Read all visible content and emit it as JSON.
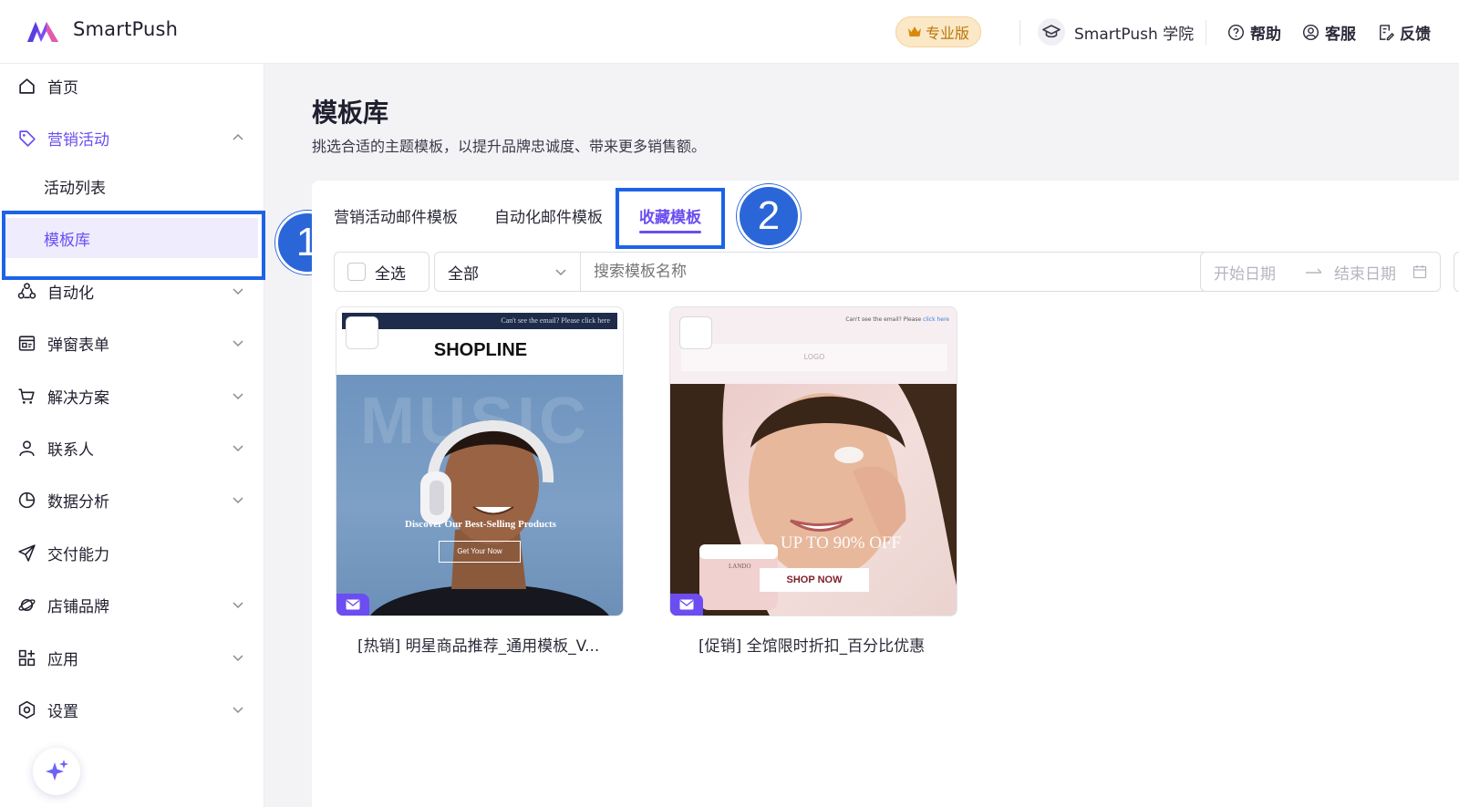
{
  "header": {
    "app_name": "SmartPush",
    "plan_label": "专业版",
    "academy_label": "SmartPush 学院",
    "help_label": "帮助",
    "service_label": "客服",
    "feedback_label": "反馈",
    "icons": [
      "smartpush-logo-icon",
      "crown-icon",
      "graduation-cap-icon",
      "help-circle-icon",
      "headset-icon",
      "feedback-icon"
    ]
  },
  "sidebar": {
    "items": [
      {
        "label": "首页",
        "icon": "home-icon"
      },
      {
        "label": "营销活动",
        "icon": "tag-icon",
        "expanded": true
      },
      {
        "label": "自动化",
        "icon": "automation-icon"
      },
      {
        "label": "弹窗表单",
        "icon": "popup-form-icon"
      },
      {
        "label": "解决方案",
        "icon": "cart-icon"
      },
      {
        "label": "联系人",
        "icon": "user-icon"
      },
      {
        "label": "数据分析",
        "icon": "pie-chart-icon"
      },
      {
        "label": "交付能力",
        "icon": "send-icon"
      },
      {
        "label": "店铺品牌",
        "icon": "planet-icon"
      },
      {
        "label": "应用",
        "icon": "apps-icon"
      },
      {
        "label": "设置",
        "icon": "settings-icon"
      }
    ],
    "sub_items": [
      {
        "label": "活动列表"
      },
      {
        "label": "模板库",
        "selected": true
      }
    ]
  },
  "annotations": {
    "step1": "1",
    "step2": "2"
  },
  "main": {
    "title": "模板库",
    "description": "挑选合适的主题模板，以提升品牌忠诚度、带来更多销售额。",
    "tabs": [
      {
        "label": "营销活动邮件模板"
      },
      {
        "label": "自动化邮件模板"
      },
      {
        "label": "收藏模板",
        "active": true
      }
    ],
    "filters": {
      "select_all_label": "全选",
      "type_select_value": "全部",
      "search_placeholder": "搜索模板名称",
      "start_date_placeholder": "开始日期",
      "end_date_placeholder": "结束日期"
    },
    "cards": [
      {
        "title": "[热销] 明星商品推荐_通用模板_V...",
        "preview_topbar_text": "Can't see the email? Please click here",
        "preview_brand": "SHOPLINE",
        "preview_bg_text": "MUSIC",
        "preview_headline": "Discover Our Best-Selling Products",
        "preview_button": "Get Your Now"
      },
      {
        "title": "[促销] 全馆限时折扣_百分比优惠",
        "preview_topbar_text": "Can't see the email? Please",
        "preview_topbar_link": "click here",
        "preview_logo": "LOGO",
        "preview_headline": "UP TO 90% OFF",
        "preview_jar_label": "LANDO",
        "preview_button": "SHOP NOW"
      }
    ]
  },
  "colors": {
    "accent": "#6b4df2",
    "highlight": "#1d63e8",
    "badge": "#2b66d8",
    "plan": "#fbe8c7"
  }
}
